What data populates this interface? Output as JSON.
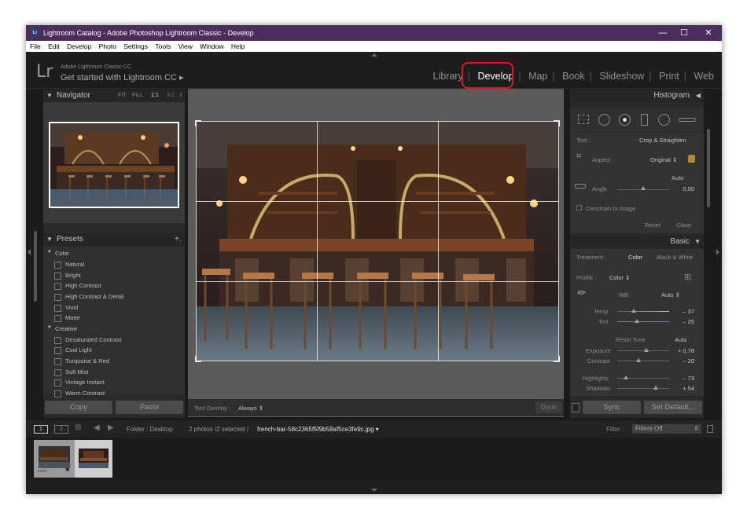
{
  "window": {
    "title": "Lightroom Catalog - Adobe Photoshop Lightroom Classic - Develop",
    "app_icon": "Lr",
    "minimize": "—",
    "maximize": "☐",
    "close": "✕"
  },
  "menu": [
    "File",
    "Edit",
    "Develop",
    "Photo",
    "Settings",
    "Tools",
    "View",
    "Window",
    "Help"
  ],
  "identity": {
    "logo": "Lr",
    "small": "Adobe Lightroom Classic CC",
    "big": "Get started with Lightroom CC"
  },
  "modules": [
    "Library",
    "Develop",
    "Map",
    "Book",
    "Slideshow",
    "Print",
    "Web"
  ],
  "active_module": "Develop",
  "navigator": {
    "title": "Navigator",
    "zoom": [
      "FIT",
      "FILL",
      "1:1",
      "3:1"
    ]
  },
  "presets": {
    "title": "Presets",
    "add": "+.",
    "groups": [
      {
        "name": "Color",
        "items": [
          "Natural",
          "Bright",
          "High Contrast",
          "High Contrast & Detail",
          "Vivid",
          "Matte"
        ]
      },
      {
        "name": "Creative",
        "items": [
          "Desaturated Contrast",
          "Cool Light",
          "Turquoise & Red",
          "Soft Mist",
          "Vintage Instant",
          "Warm Contrast"
        ]
      }
    ]
  },
  "left_buttons": {
    "copy": "Copy",
    "paste": "Paste"
  },
  "toolbar": {
    "label": "Tool Overlay :",
    "value": "Always",
    "done": "Done"
  },
  "histogram": {
    "title": "Histogram"
  },
  "crop": {
    "tool_label": "Tool :",
    "tool_value": "Crop & Straighten",
    "aspect_label": "Aspect :",
    "aspect_value": "Original",
    "auto": "Auto",
    "angle_label": "Angle",
    "angle_value": "0,00",
    "constrain": "Constrain to Image",
    "reset": "Reset",
    "close": "Close"
  },
  "basic": {
    "title": "Basic",
    "treatment_label": "Treatment :",
    "color": "Color",
    "bw": "Black & White",
    "profile_label": "Profile :",
    "profile_value": "Color",
    "wb_label": "WB :",
    "wb_value": "Auto",
    "temp_label": "Temp",
    "temp_value": "– 37",
    "tint_label": "Tint",
    "tint_value": "– 25",
    "reset_tone": "Reset Tone",
    "tone_auto": "Auto",
    "exposure_label": "Exposure",
    "exposure_value": "+ 0,78",
    "contrast_label": "Contrast",
    "contrast_value": "– 20",
    "highlights_label": "Highlights",
    "highlights_value": "– 73",
    "shadows_label": "Shadows",
    "shadows_value": "+ 54"
  },
  "right_buttons": {
    "sync": "Sync",
    "set_default": "Set Default..."
  },
  "filmstrip": {
    "page1": "1",
    "page2": "2",
    "folder": "Folder : Desktop",
    "count": "2 photos /2 selected /",
    "filename": "french-bar-58c2365f5f9b58af5ce3fe9c.jpg",
    "filter_label": "Filter :",
    "filter_value": "Filters Off",
    "stars": "••••"
  }
}
